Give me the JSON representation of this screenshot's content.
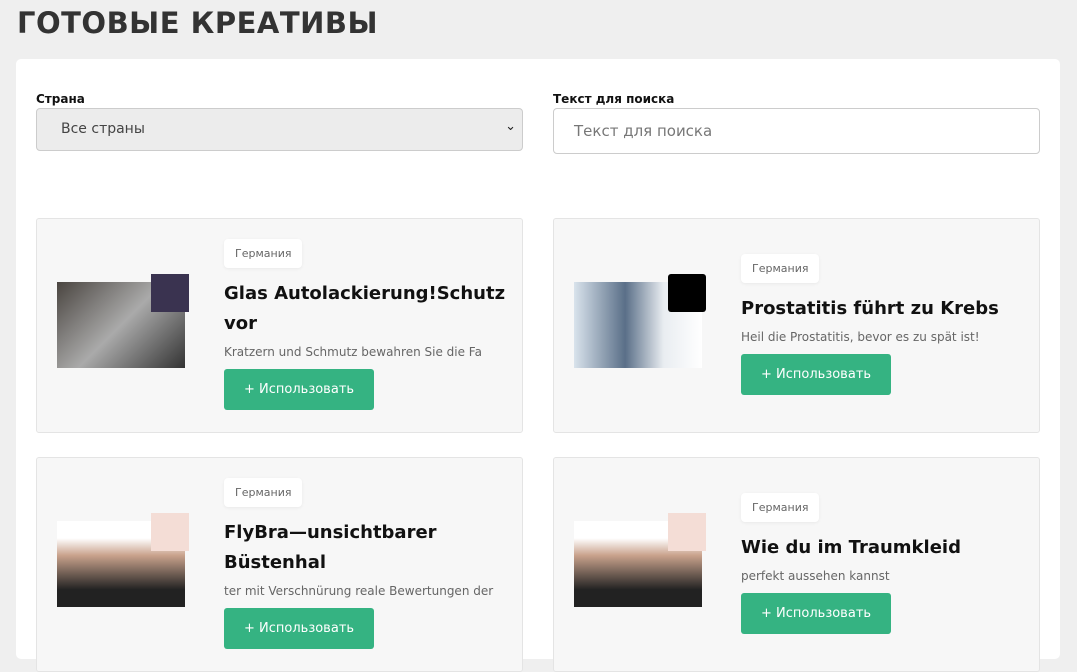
{
  "page_title": "ГОТОВЫЕ КРЕАТИВЫ",
  "filters": {
    "country_label": "Страна",
    "country_value": "Все страны",
    "search_label": "Текст для поиска",
    "search_placeholder": "Текст для поиска"
  },
  "cards": [
    {
      "country": "Германия",
      "title": "Glas Autolackierung!Schutz vor",
      "desc": "Kratzern und Schmutz bewahren Sie die Fa",
      "button": "+ Использовать"
    },
    {
      "country": "Германия",
      "title": "Prostatitis führt zu Krebs",
      "desc": "Heil die Prostatitis, bevor es zu spät ist!",
      "button": "+ Использовать"
    },
    {
      "country": "Германия",
      "title": "FlyBra—unsichtbarer Büstenhal",
      "desc": "ter mit Verschnürung reale Bewertungen der",
      "button": "+ Использовать"
    },
    {
      "country": "Германия",
      "title": "Wie du im Traumkleid",
      "desc": "perfekt aussehen kannst",
      "button": "+ Использовать"
    }
  ]
}
